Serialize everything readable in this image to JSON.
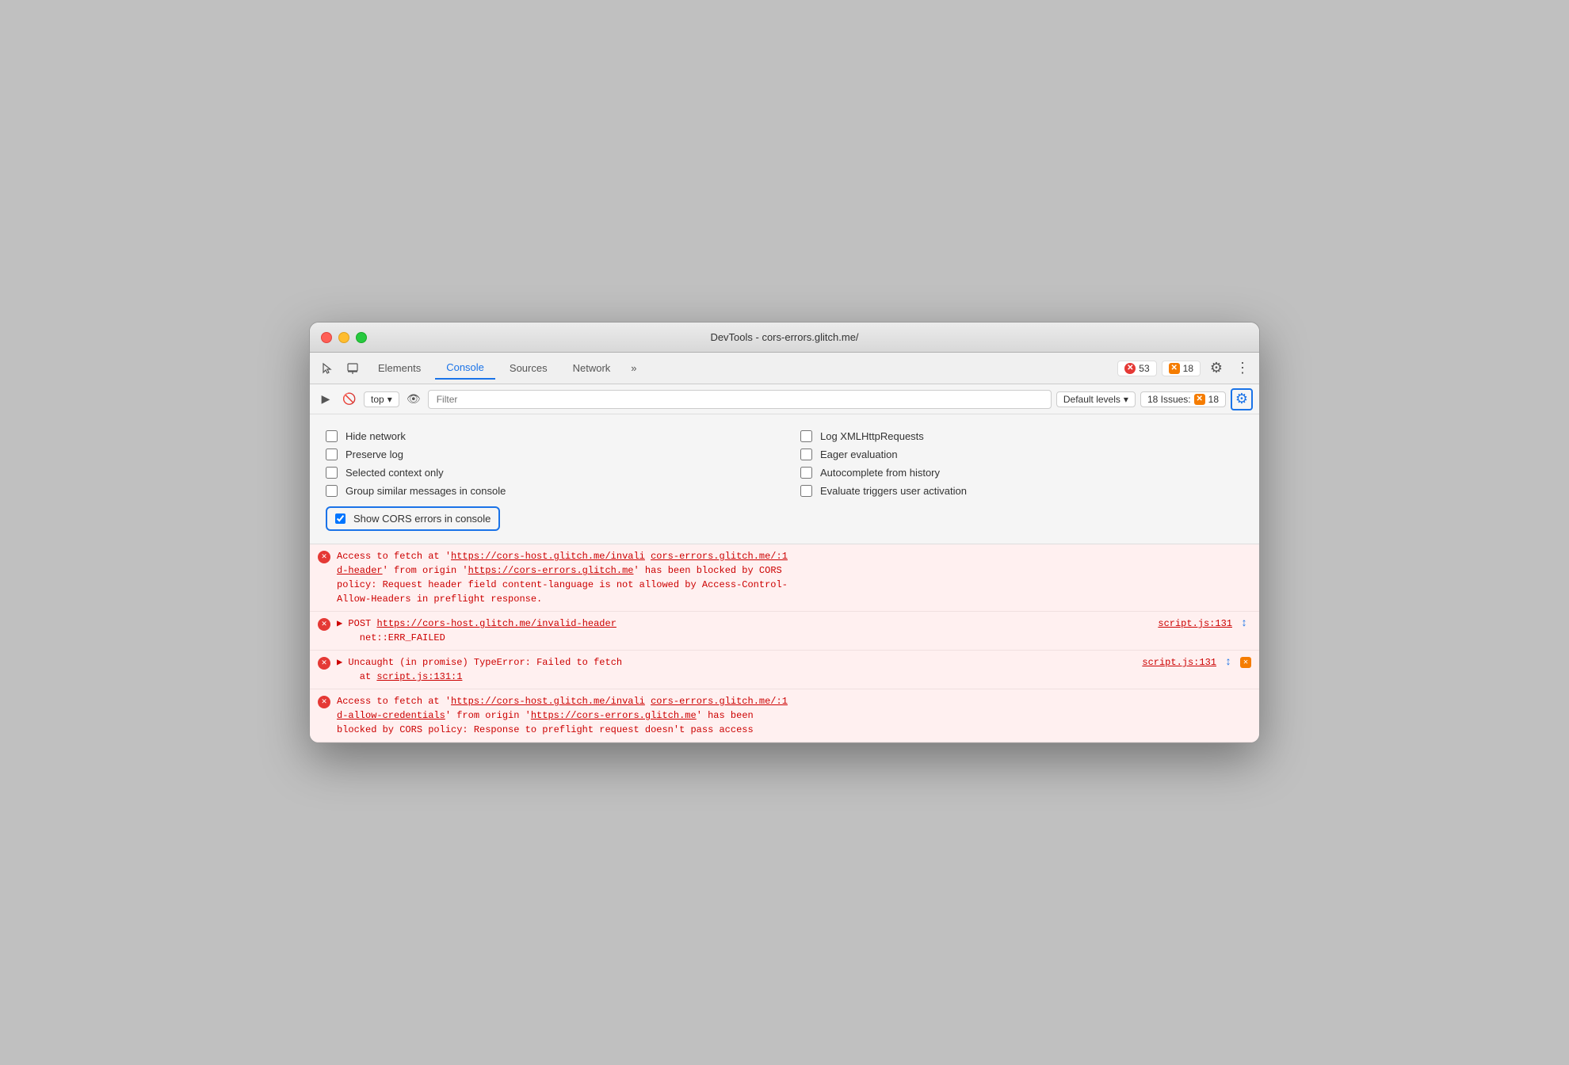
{
  "window": {
    "title": "DevTools - cors-errors.glitch.me/"
  },
  "toolbar": {
    "tabs": [
      {
        "id": "elements",
        "label": "Elements",
        "active": false
      },
      {
        "id": "console",
        "label": "Console",
        "active": true
      },
      {
        "id": "sources",
        "label": "Sources",
        "active": false
      },
      {
        "id": "network",
        "label": "Network",
        "active": false
      }
    ],
    "more_label": "»",
    "error_count": "53",
    "warning_count": "18",
    "gear_label": "⚙",
    "more_dots": "⋮"
  },
  "console_toolbar": {
    "play_icon": "▶",
    "ban_icon": "🚫",
    "context_label": "top",
    "dropdown_icon": "▾",
    "eye_icon": "👁",
    "filter_placeholder": "Filter",
    "levels_label": "Default levels",
    "levels_dropdown": "▾",
    "issues_label": "18 Issues:",
    "issues_count": "18",
    "settings_icon": "⚙"
  },
  "settings": {
    "checkboxes": [
      {
        "id": "hide_network",
        "label": "Hide network",
        "checked": false,
        "col": 0
      },
      {
        "id": "log_xml",
        "label": "Log XMLHttpRequests",
        "checked": false,
        "col": 1
      },
      {
        "id": "preserve_log",
        "label": "Preserve log",
        "checked": false,
        "col": 0
      },
      {
        "id": "eager_eval",
        "label": "Eager evaluation",
        "checked": false,
        "col": 1
      },
      {
        "id": "selected_context",
        "label": "Selected context only",
        "checked": false,
        "col": 0
      },
      {
        "id": "autocomplete",
        "label": "Autocomplete from history",
        "checked": false,
        "col": 1
      },
      {
        "id": "group_similar",
        "label": "Group similar messages in console",
        "checked": false,
        "col": 0
      },
      {
        "id": "evaluate_triggers",
        "label": "Evaluate triggers user activation",
        "checked": false,
        "col": 1
      }
    ],
    "show_cors": {
      "id": "show_cors",
      "label": "Show CORS errors in console",
      "checked": true
    }
  },
  "console_entries": [
    {
      "id": "entry1",
      "type": "error",
      "text_parts": [
        {
          "text": "Access to fetch at '",
          "link": false
        },
        {
          "text": "https://cors-host.glitch.me/invali",
          "link": true
        },
        {
          "text": " ",
          "link": false
        },
        {
          "text": "cors-errors.glitch.me/:1",
          "link": true
        },
        {
          "text": "d-header",
          "link": true
        },
        {
          "text": "' from origin '",
          "link": false
        },
        {
          "text": "https://cors-errors.glitch.me",
          "link": true
        },
        {
          "text": "' has been blocked by CORS policy: Request header field content-language is not allowed by Access-Control-Allow-Headers in preflight response.",
          "link": false
        }
      ],
      "full_text": "Access to fetch at 'https://cors-host.glitch.me/invali cors-errors.glitch.me/:1 d-header' from origin 'https://cors-errors.glitch.me' has been blocked by CORS policy: Request header field content-language is not allowed by Access-Control-Allow-Headers in preflight response."
    },
    {
      "id": "entry2",
      "type": "error",
      "expandable": true,
      "main_text": "POST ",
      "link_text": "https://cors-host.glitch.me/invalid-header",
      "sub_text": "net::ERR_FAILED",
      "source": "script.js:131",
      "has_nav": true
    },
    {
      "id": "entry3",
      "type": "error",
      "expandable": true,
      "main_text": "Uncaught (in promise) TypeError: Failed to fetch",
      "link_text": "",
      "sub_text": "at script.js:131:1",
      "sub_link": "script.js:131:1",
      "source": "script.js:131",
      "has_nav": true,
      "has_close": true
    },
    {
      "id": "entry4",
      "type": "error",
      "text_parts": [
        {
          "text": "Access to fetch at '",
          "link": false
        },
        {
          "text": "https://cors-host.glitch.me/invali",
          "link": true
        },
        {
          "text": " ",
          "link": false
        },
        {
          "text": "cors-errors.glitch.me/:1",
          "link": true
        },
        {
          "text": "d-allow-credentials",
          "link": true
        },
        {
          "text": "' from origin '",
          "link": false
        },
        {
          "text": "https://cors-errors.glitch.me",
          "link": true
        },
        {
          "text": "' has been blocked by CORS policy: Response to preflight request doesn't pass access",
          "link": false
        }
      ],
      "full_text": "Access to fetch at 'https://cors-host.glitch.me/invali cors-errors.glitch.me/:1 d-allow-credentials' from origin 'https://cors-errors.glitch.me' has been blocked by CORS policy: Response to preflight request doesn't pass access"
    }
  ]
}
